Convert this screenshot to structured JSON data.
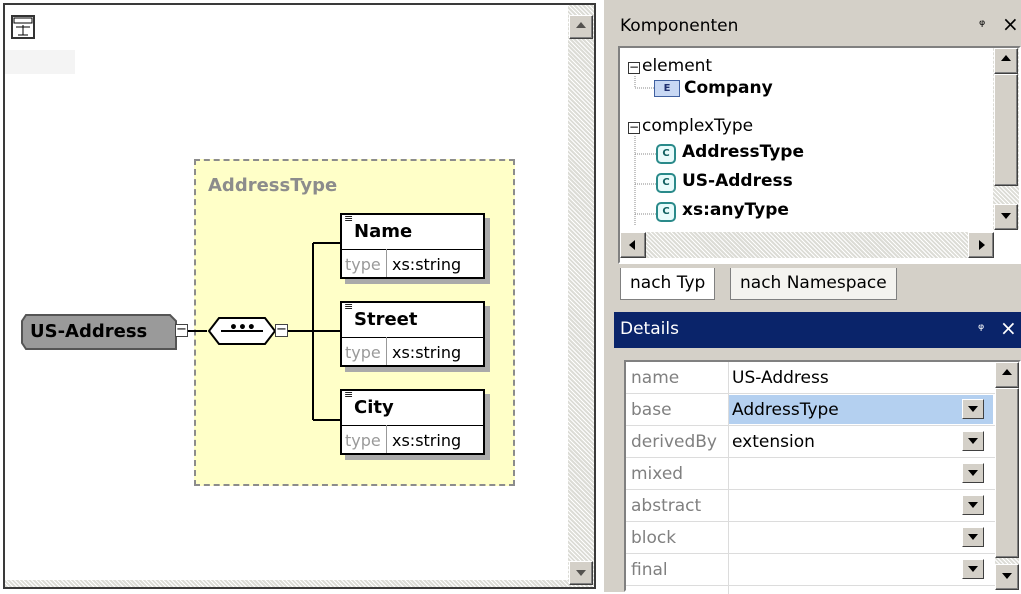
{
  "diagram": {
    "root_element": "US-Address",
    "group_title": "AddressType",
    "elements": [
      {
        "name": "Name",
        "type_label": "type",
        "type_value": "xs:string"
      },
      {
        "name": "Street",
        "type_label": "type",
        "type_value": "xs:string"
      },
      {
        "name": "City",
        "type_label": "type",
        "type_value": "xs:string"
      }
    ],
    "sequence_symbol": "•••",
    "expander_symbol": "−"
  },
  "components": {
    "title": "Komponenten",
    "pin": "₀",
    "close": "×",
    "tree": [
      {
        "kind": "group",
        "label": "element"
      },
      {
        "kind": "item",
        "icon": "E",
        "label": "Company"
      },
      {
        "kind": "group",
        "label": "complexType"
      },
      {
        "kind": "item",
        "icon": "C",
        "label": "AddressType"
      },
      {
        "kind": "item",
        "icon": "C",
        "label": "US-Address"
      },
      {
        "kind": "item",
        "icon": "C",
        "label": "xs:anyType"
      }
    ],
    "tabs": [
      {
        "label": "nach Typ",
        "active": true
      },
      {
        "label": "nach Namespace",
        "active": false
      }
    ]
  },
  "details": {
    "title": "Details",
    "close": "×",
    "rows": [
      {
        "name": "name",
        "value": "US-Address",
        "dropdown": false
      },
      {
        "name": "base",
        "value": "AddressType",
        "dropdown": true
      },
      {
        "name": "derivedBy",
        "value": "extension",
        "dropdown": true
      },
      {
        "name": "mixed",
        "value": "",
        "dropdown": true
      },
      {
        "name": "abstract",
        "value": "",
        "dropdown": true
      },
      {
        "name": "block",
        "value": "",
        "dropdown": true
      },
      {
        "name": "final",
        "value": "",
        "dropdown": true
      }
    ]
  },
  "colors": {
    "details_header": "#0a246a",
    "selection": "#b4d0f0",
    "group_fill": "#ffffc8"
  }
}
